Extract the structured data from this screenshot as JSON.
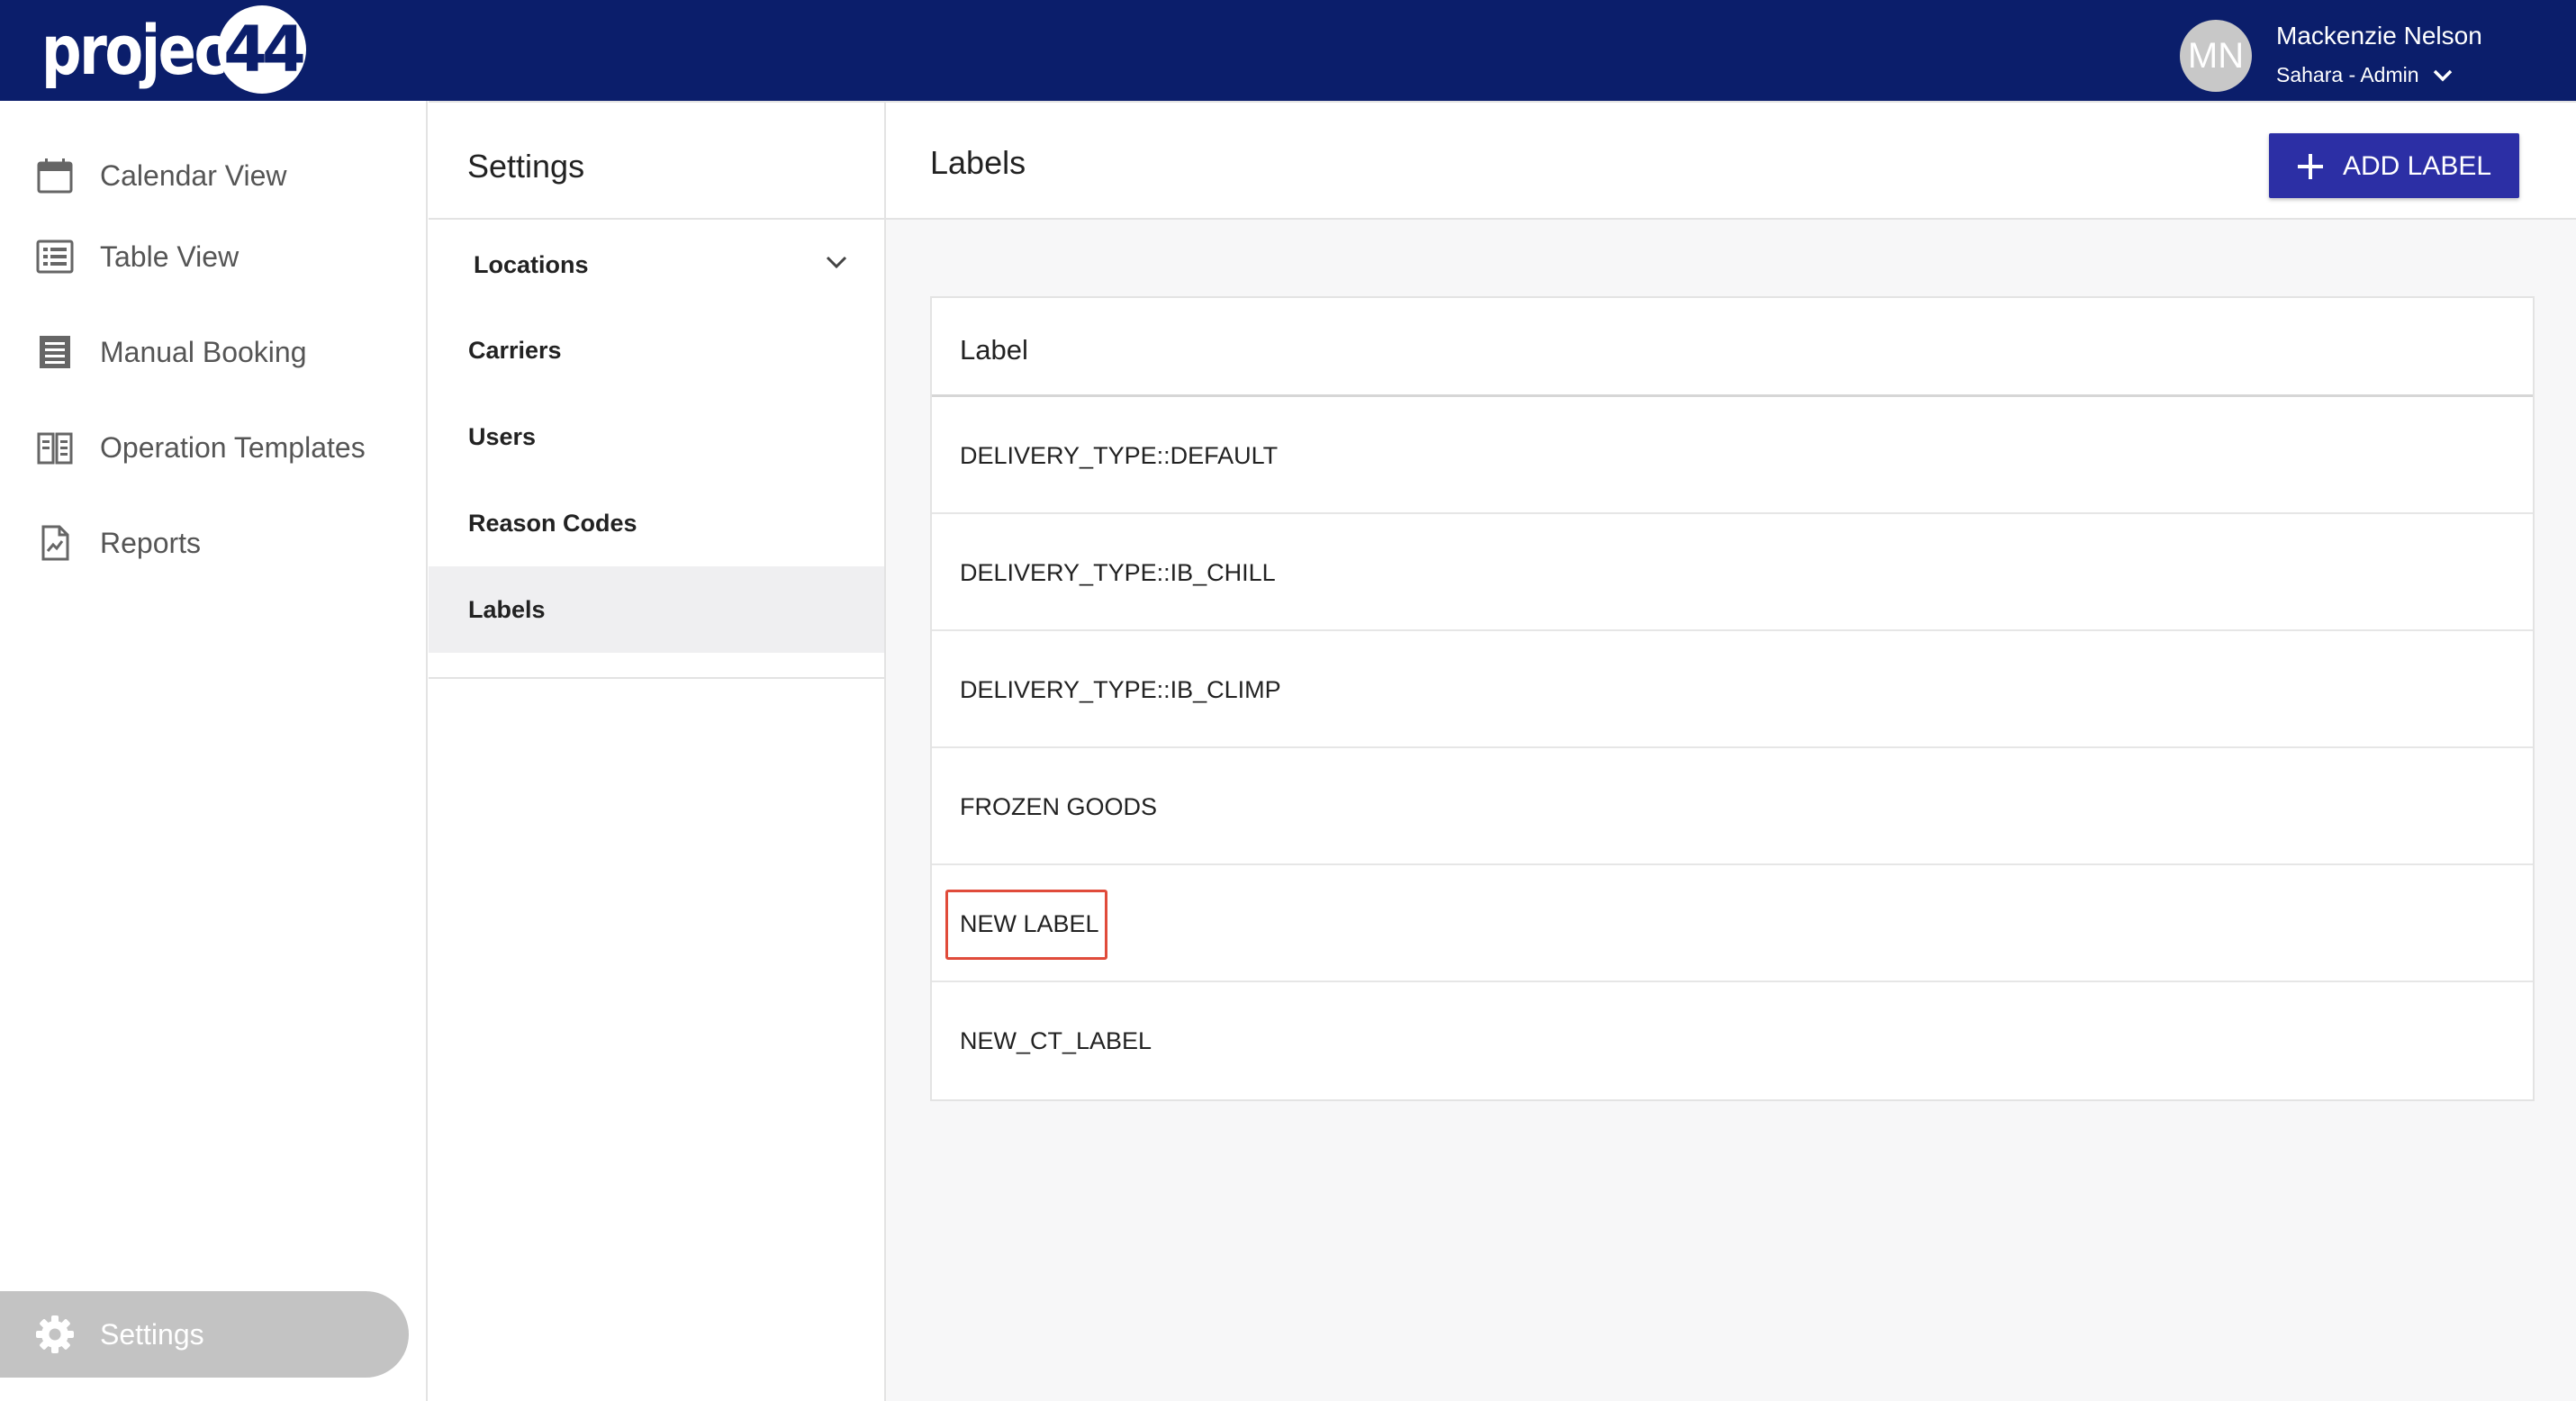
{
  "header": {
    "logo_text": "project",
    "logo_number": "44",
    "user": {
      "initials": "MN",
      "name": "Mackenzie Nelson",
      "role": "Sahara - Admin"
    }
  },
  "sidebar": {
    "items": [
      {
        "label": "Calendar View",
        "icon": "calendar-icon"
      },
      {
        "label": "Table View",
        "icon": "list-icon"
      },
      {
        "label": "Manual Booking",
        "icon": "document-icon"
      },
      {
        "label": "Operation Templates",
        "icon": "book-icon"
      },
      {
        "label": "Reports",
        "icon": "report-icon"
      }
    ],
    "settings_label": "Settings"
  },
  "settings_menu": {
    "title": "Settings",
    "items": [
      {
        "label": "Locations"
      },
      {
        "label": "Carriers"
      },
      {
        "label": "Users"
      },
      {
        "label": "Reason Codes"
      },
      {
        "label": "Labels"
      }
    ],
    "active": "Labels"
  },
  "main": {
    "title": "Labels",
    "add_button_label": "ADD LABEL",
    "table": {
      "column_header": "Label",
      "rows": [
        "DELIVERY_TYPE::DEFAULT",
        "DELIVERY_TYPE::IB_CHILL",
        "DELIVERY_TYPE::IB_CLIMP",
        "FROZEN GOODS",
        "NEW LABEL",
        "NEW_CT_LABEL"
      ],
      "highlighted_row": "NEW LABEL"
    }
  },
  "colors": {
    "topbar": "#0b1e6b",
    "primary_button": "#2c2fa5",
    "highlight_border": "#e04b3a"
  }
}
